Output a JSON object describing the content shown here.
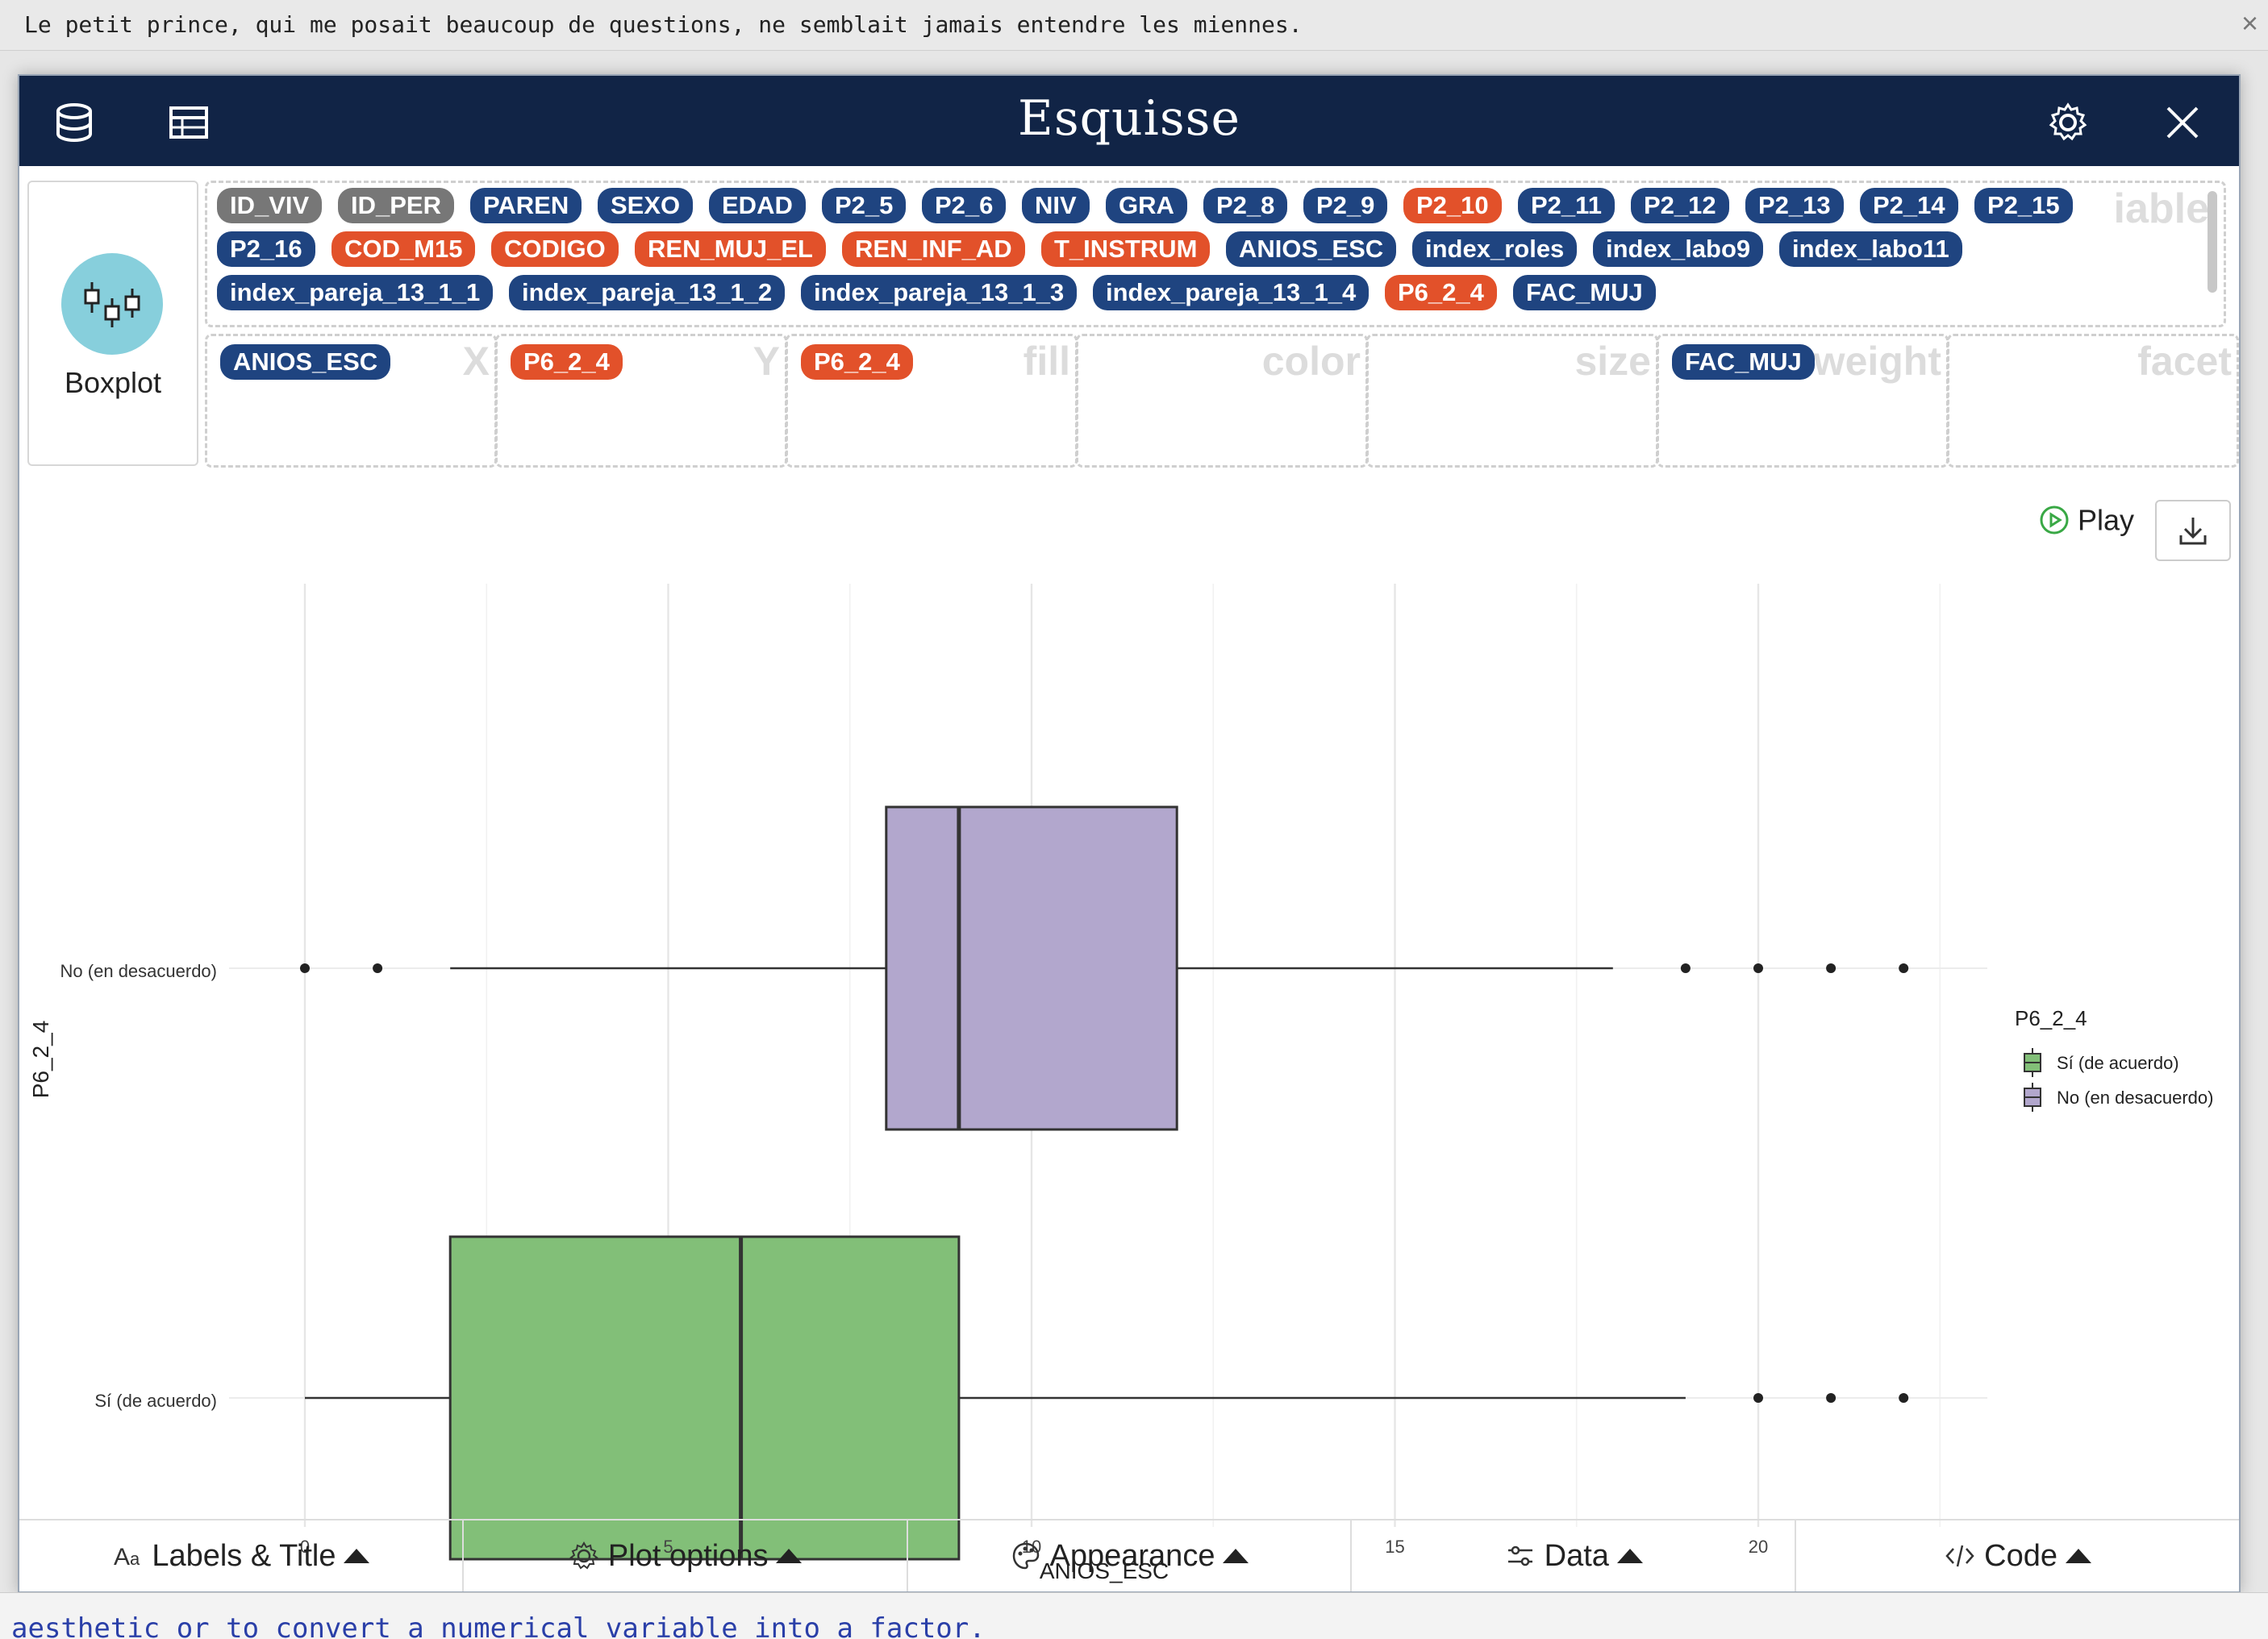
{
  "notification": {
    "text": "Le petit prince, qui me posait beaucoup de questions, ne semblait jamais entendre les miennes.",
    "close": "×"
  },
  "code_strip": {
    "text": "aesthetic or to convert a numerical variable into a factor."
  },
  "header": {
    "title": "Esquisse",
    "icons": [
      "database-icon",
      "table-icon",
      "gear-icon",
      "close-icon"
    ]
  },
  "geom": {
    "label": "Boxplot"
  },
  "variables": {
    "ghost_label": "iable",
    "rows": [
      [
        {
          "name": "ID_VIV",
          "type": "gray"
        },
        {
          "name": "ID_PER",
          "type": "gray"
        },
        {
          "name": "PAREN",
          "type": "blue"
        },
        {
          "name": "SEXO",
          "type": "blue"
        },
        {
          "name": "EDAD",
          "type": "blue"
        },
        {
          "name": "P2_5",
          "type": "blue"
        },
        {
          "name": "P2_6",
          "type": "blue"
        },
        {
          "name": "NIV",
          "type": "blue"
        },
        {
          "name": "GRA",
          "type": "blue"
        },
        {
          "name": "P2_8",
          "type": "blue"
        },
        {
          "name": "P2_9",
          "type": "blue"
        },
        {
          "name": "P2_10",
          "type": "red"
        },
        {
          "name": "P2_11",
          "type": "blue"
        },
        {
          "name": "P2_12",
          "type": "blue"
        },
        {
          "name": "P2_13",
          "type": "blue"
        },
        {
          "name": "P2_14",
          "type": "blue"
        },
        {
          "name": "P2_15",
          "type": "blue"
        }
      ],
      [
        {
          "name": "P2_16",
          "type": "blue"
        },
        {
          "name": "COD_M15",
          "type": "red"
        },
        {
          "name": "CODIGO",
          "type": "red"
        },
        {
          "name": "REN_MUJ_EL",
          "type": "red"
        },
        {
          "name": "REN_INF_AD",
          "type": "red"
        },
        {
          "name": "T_INSTRUM",
          "type": "red"
        },
        {
          "name": "ANIOS_ESC",
          "type": "blue"
        },
        {
          "name": "index_roles",
          "type": "blue"
        },
        {
          "name": "index_labo9",
          "type": "blue"
        },
        {
          "name": "index_labo11",
          "type": "blue"
        }
      ],
      [
        {
          "name": "index_pareja_13_1_1",
          "type": "blue"
        },
        {
          "name": "index_pareja_13_1_2",
          "type": "blue"
        },
        {
          "name": "index_pareja_13_1_3",
          "type": "blue"
        },
        {
          "name": "index_pareja_13_1_4",
          "type": "blue"
        },
        {
          "name": "P6_2_4",
          "type": "red"
        },
        {
          "name": "FAC_MUJ",
          "type": "blue"
        }
      ]
    ]
  },
  "zones": [
    {
      "label": "X",
      "chip": "ANIOS_ESC",
      "type": "blue"
    },
    {
      "label": "Y",
      "chip": "P6_2_4",
      "type": "red"
    },
    {
      "label": "fill",
      "chip": "P6_2_4",
      "type": "red"
    },
    {
      "label": "color",
      "chip": "",
      "type": ""
    },
    {
      "label": "size",
      "chip": "",
      "type": ""
    },
    {
      "label": "weight",
      "chip": "FAC_MUJ",
      "type": "blue"
    },
    {
      "label": "facet",
      "chip": "",
      "type": ""
    }
  ],
  "play": {
    "label": "Play"
  },
  "chart_data": {
    "type": "boxplot",
    "orientation": "horizontal",
    "xlabel": "ANIOS_ESC",
    "ylabel": "P6_2_4",
    "xlim": [
      0,
      23
    ],
    "xticks": [
      0,
      5,
      10,
      15,
      20
    ],
    "grid": true,
    "legend": {
      "title": "P6_2_4",
      "position": "right"
    },
    "series": [
      {
        "name": "Sí (de acuerdo)",
        "color": "#82bf78",
        "whisker_low": 0,
        "q1": 2,
        "median": 6,
        "q3": 9,
        "whisker_high": 19,
        "outliers": [
          20,
          21,
          22
        ]
      },
      {
        "name": "No (en desacuerdo)",
        "color": "#b2a7cd",
        "whisker_low": 2,
        "q1": 8,
        "median": 9,
        "q3": 12,
        "whisker_high": 18,
        "outliers": [
          0,
          1,
          19,
          20,
          21,
          22
        ]
      }
    ]
  },
  "tabs": [
    {
      "label": "Labels & Title",
      "icon": "text-icon"
    },
    {
      "label": "Plot options",
      "icon": "gear-icon"
    },
    {
      "label": "Appearance",
      "icon": "palette-icon"
    },
    {
      "label": "Data",
      "icon": "sliders-icon"
    },
    {
      "label": "Code",
      "icon": "code-icon"
    }
  ]
}
